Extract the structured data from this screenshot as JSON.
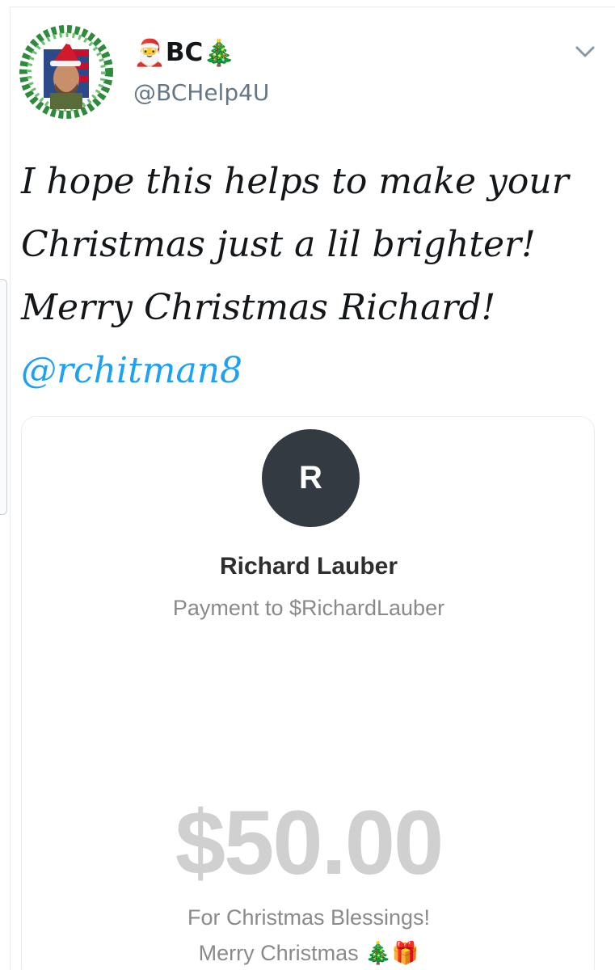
{
  "tweet": {
    "author": {
      "name_prefix_emoji": "🎅",
      "name": "BC",
      "name_suffix_emoji": "🎄",
      "handle": "@BCHelp4U"
    },
    "text": "I hope this helps to make your Christmas just a lil brighter! Merry Christmas Richard! ",
    "mention": "@rchitman8"
  },
  "payment_card": {
    "avatar_initial": "R",
    "recipient_name": "Richard Lauber",
    "payment_to": "Payment to $RichardLauber",
    "amount": "$50.00",
    "note_line1": "For Christmas Blessings!",
    "note_line2": "Merry Christmas 🎄🎁"
  },
  "icons": {
    "menu": "chevron-down-icon",
    "avatar": "profile-avatar-icon"
  },
  "colors": {
    "mention": "#1da1f2",
    "handle": "#657786",
    "pay_avatar_bg": "#333a42",
    "amount": "#d0d0d0"
  }
}
